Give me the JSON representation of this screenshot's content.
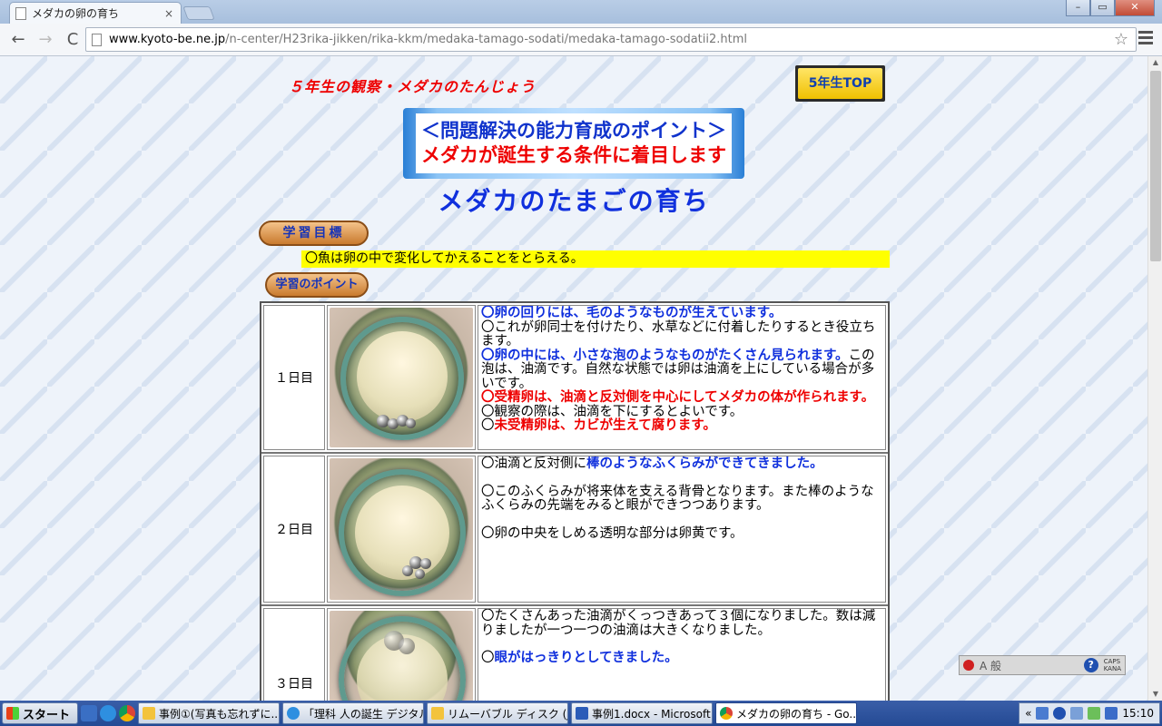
{
  "browser": {
    "tab_title": "メダカの卵の育ち",
    "tab_close": "×",
    "url_host": "www.kyoto-be.ne.jp",
    "url_path": "/n-center/H23rika-jikken/rika-kkm/medaka-tamago-sodati/medaka-tamago-sodatii2.html",
    "back": "←",
    "forward": "→",
    "reload": "C",
    "star": "☆",
    "win_min": "–",
    "win_max": "▭",
    "win_close": "✕"
  },
  "page": {
    "subtitle": "５年生の観察・メダカのたんじょう",
    "top_button": "5年生TOP",
    "point_line1": "＜問題解決の能力育成のポイント＞",
    "point_line2": "メダカが誕生する条件に着目します",
    "title": "メダカのたまごの育ち",
    "goal_label": "学習目標",
    "goal_text": "〇魚は卵の中で変化してかえることをとらえる。",
    "points_label": "学習のポイント",
    "rows": [
      {
        "day": "１日目",
        "t1": "〇卵の回りには、毛のようなものが生えています。",
        "t2": "〇これが卵同士を付けたり、水草などに付着したりするとき役立ちます。",
        "t3": "〇卵の中には、小さな泡のようなものがたくさん見られます。",
        "t4": "この泡は、油滴です。自然な状態では卵は油滴を上にしている場合が多いです。",
        "t5": "〇受精卵は、油滴と反対側を中心にしてメダカの体が作られます。",
        "t6": "〇観察の際は、油滴を下にするとよいです。",
        "t7a": "〇",
        "t7b": "未受精卵は、カビが生えて腐ります。"
      },
      {
        "day": "２日目",
        "t1a": "〇油滴と反対側に",
        "t1b": "棒のようなふくらみができてきました。",
        "t2": "〇このふくらみが将来体を支える背骨となります。また棒のようなふくらみの先端をみると眼ができつつあります。",
        "t3": "〇卵の中央をしめる透明な部分は卵黄です。"
      },
      {
        "day": "３日目",
        "t1": "〇たくさんあった油滴がくっつきあって３個になりました。数は減りましたが一つ一つの油滴は大きくなりました。",
        "t2a": "〇",
        "t2b": "眼がはっきりとしてきました。"
      }
    ]
  },
  "ime": {
    "mode": "A 般",
    "help": "?",
    "caps": "CAPS",
    "kana": "KANA"
  },
  "taskbar": {
    "start": "スタート",
    "tasks": [
      "事例①(写真も忘れずに...",
      "「理科 人の誕生 デジタル...",
      "リムーバブル ディスク (J:)",
      "事例1.docx - Microsoft ...",
      "メダカの卵の育ち - Go..."
    ],
    "clock": "15:10",
    "tray_expand": "«"
  },
  "colors": {
    "accent_blue": "#1030dd",
    "accent_red": "#e00000",
    "highlight_yellow": "#ffff00"
  }
}
